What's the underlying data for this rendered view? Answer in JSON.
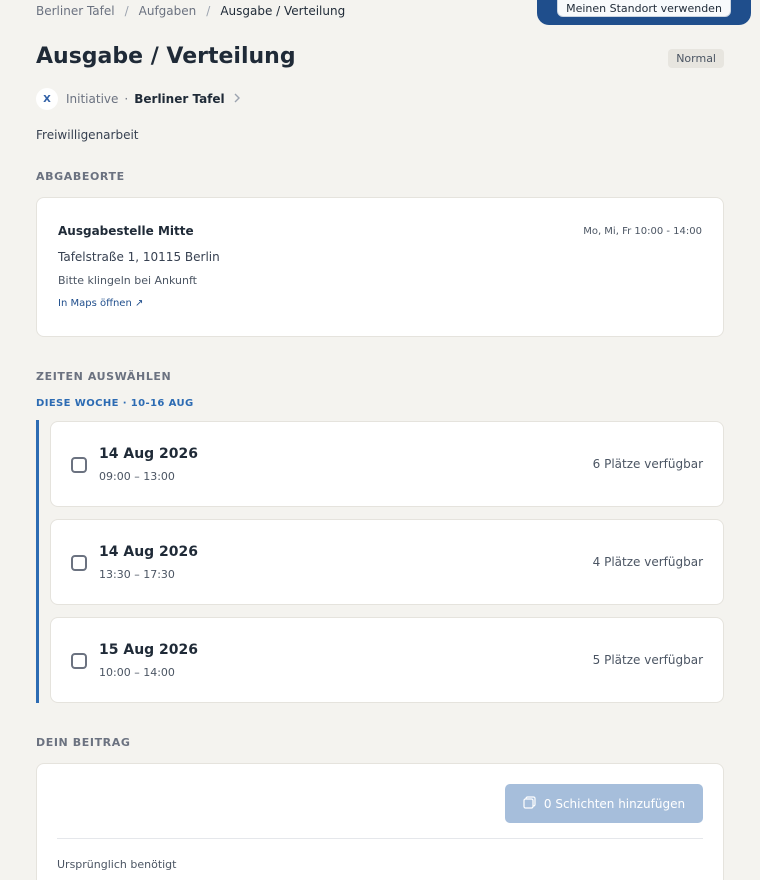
{
  "breadcrumb": [
    "Berliner Tafel",
    "Aufgaben",
    "Ausgabe / Verteilung"
  ],
  "header": {
    "location_button": "Meinen Standort verwenden",
    "title": "Ausgabe / Verteilung",
    "priority_badge": "Normal"
  },
  "org": {
    "logo_text": "X",
    "type": "Initiative",
    "separator": "·",
    "name": "Berliner Tafel"
  },
  "category": "Freiwilligenarbeit",
  "sections": {
    "locations": "ABGABEORTE",
    "times": "ZEITEN AUSWÄHLEN",
    "contribution": "DEIN BEITRAG"
  },
  "location": {
    "name": "Ausgabestelle Mitte",
    "hours": "Mo, Mi, Fr  10:00 - 14:00",
    "address": "Tafelstraße 1, 10115 Berlin",
    "note": "Bitte klingeln bei Ankunft",
    "maps_link": "In Maps öffnen ↗"
  },
  "week_label": "DIESE WOCHE · 10-16 AUG",
  "shifts": [
    {
      "date": "14 Aug 2026",
      "time": "09:00 – 13:00",
      "spots": "6 Plätze verfügbar",
      "checked": false
    },
    {
      "date": "14 Aug 2026",
      "time": "13:30 – 17:30",
      "spots": "4 Plätze verfügbar",
      "checked": false
    },
    {
      "date": "15 Aug 2026",
      "time": "10:00 – 14:00",
      "spots": "5 Plätze verfügbar",
      "checked": false
    }
  ],
  "contribution": {
    "add_button": "0 Schichten hinzufügen",
    "needed_label": "Ursprünglich benötigt"
  },
  "colors": {
    "background": "#f4f3ef",
    "accent": "#2c6bb3",
    "header_blue": "#1f4e8c",
    "button_disabled": "#a6bedb"
  }
}
